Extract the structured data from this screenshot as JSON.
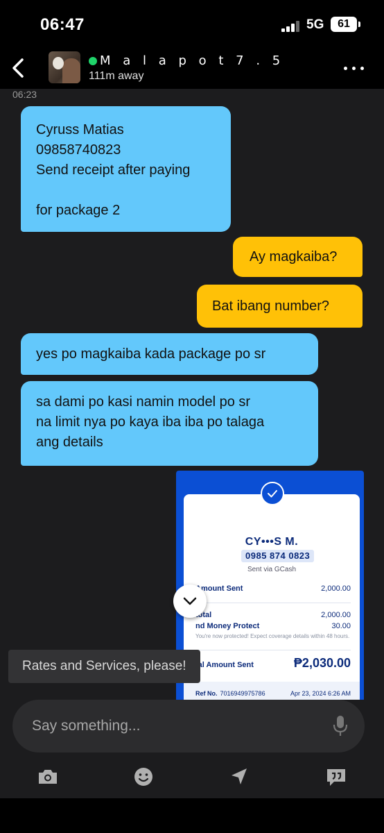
{
  "status_bar": {
    "time": "06:47",
    "network": "5G",
    "battery": "61"
  },
  "header": {
    "contact_name": "M a l a p o t 7 .  5",
    "distance": "111m away"
  },
  "chat": {
    "timestamp": "06:23",
    "messages": [
      {
        "direction": "received",
        "text": "Cyruss Matias\n09858740823\nSend receipt after paying\n\nfor package 2"
      },
      {
        "direction": "sent",
        "text": "Ay magkaiba?"
      },
      {
        "direction": "sent",
        "text": "Bat ibang number?"
      },
      {
        "direction": "received",
        "text": "yes po magkaiba kada package po sr"
      },
      {
        "direction": "received",
        "text": "sa dami po kasi namin model po sr\nna limit nya po kaya iba iba po talaga\nang details"
      }
    ],
    "receipt": {
      "name": "CY•••S M.",
      "number": "0985 874 0823",
      "via": "Sent via GCash",
      "amount_sent_label": "Amount Sent",
      "amount_sent_value": "2,000.00",
      "subtotal_label": "total",
      "subtotal_value": "2,000.00",
      "protect_label": "nd Money Protect",
      "protect_value": "30.00",
      "protect_note": "You're now protected! Expect coverage details within 48 hours.",
      "total_label": "tal Amount Sent",
      "total_value": "₱2,030.00",
      "ref_label": "Ref No.",
      "ref_value": "7016949975786",
      "date": "Apr 23, 2024 6:26 AM"
    }
  },
  "suggestion": {
    "text": "Rates and Services, please!"
  },
  "composer": {
    "placeholder": "Say something..."
  },
  "toolbar": {
    "icons": [
      "camera-icon",
      "emoji-icon",
      "location-icon",
      "quick-reply-icon"
    ]
  },
  "colors": {
    "received_bubble": "#63c8fb",
    "sent_bubble": "#ffc107",
    "online": "#1fd36a",
    "gcash_blue": "#0b4fd4"
  }
}
